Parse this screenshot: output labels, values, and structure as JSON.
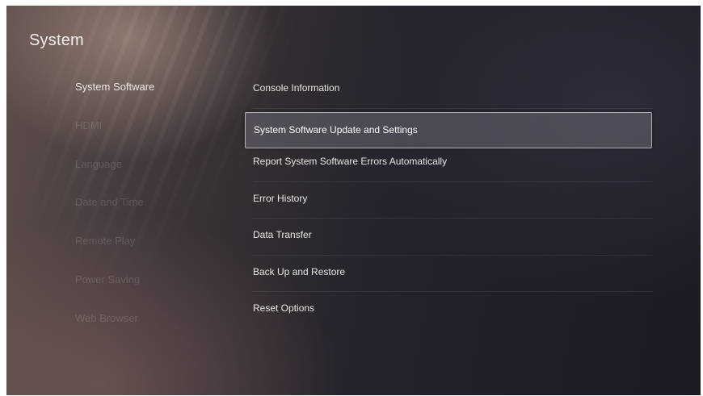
{
  "header": {
    "title": "System"
  },
  "sidebar": {
    "items": [
      {
        "label": "System Software"
      },
      {
        "label": "HDMI"
      },
      {
        "label": "Language"
      },
      {
        "label": "Date and Time"
      },
      {
        "label": "Remote Play"
      },
      {
        "label": "Power Saving"
      },
      {
        "label": "Web Browser"
      }
    ]
  },
  "content": {
    "items": [
      {
        "label": "Console Information"
      },
      {
        "label": "System Software Update and Settings"
      },
      {
        "label": "Report System Software Errors Automatically"
      },
      {
        "label": "Error History"
      },
      {
        "label": "Data Transfer"
      },
      {
        "label": "Back Up and Restore"
      },
      {
        "label": "Reset Options"
      }
    ]
  }
}
